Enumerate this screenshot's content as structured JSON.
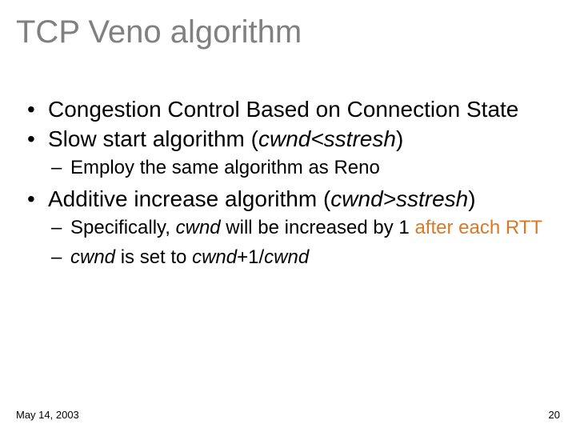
{
  "title": "TCP Veno algorithm",
  "bullets": {
    "b1": "Congestion Control Based on Connection State",
    "b2_pre": "Slow start algorithm (",
    "b2_var": "cwnd<sstresh",
    "b2_post": ")",
    "b2_sub1": "Employ the same algorithm as Reno",
    "b3_pre": "Additive increase algorithm (",
    "b3_var": "cwnd>sstresh",
    "b3_post": ")",
    "b3_sub1_a": "Specifically, ",
    "b3_sub1_var": "cwnd",
    "b3_sub1_b": " will be increased by 1 ",
    "b3_sub1_orange": "after each RTT",
    "b3_sub2_a": "",
    "b3_sub2_var1": "cwnd",
    "b3_sub2_b": " is set to ",
    "b3_sub2_var2": "cwnd",
    "b3_sub2_c": "+1/",
    "b3_sub2_var3": "cwnd"
  },
  "footer": {
    "date": "May 14, 2003",
    "page": "20"
  }
}
